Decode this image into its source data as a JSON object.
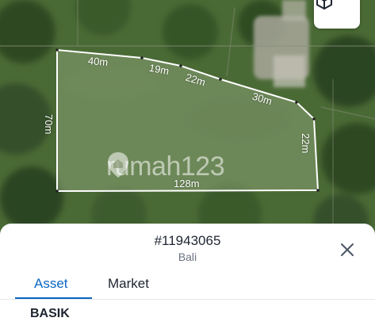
{
  "map": {
    "watermark_text": "rumah123",
    "view_3d_icon": "cube-icon",
    "dimensions": {
      "top_1": "40m",
      "top_2": "19m",
      "top_3": "22m",
      "top_4": "30m",
      "left": "70m",
      "right": "22m",
      "bottom": "128m"
    },
    "plot_outline_color": "#ffffff"
  },
  "sheet": {
    "listing_id": "#11943065",
    "location": "Bali",
    "close_icon": "close-icon",
    "tabs": [
      {
        "label": "Asset",
        "active": true
      },
      {
        "label": "Market",
        "active": false
      }
    ],
    "section_title": "BASIK",
    "accent_color": "#0a66c2"
  }
}
